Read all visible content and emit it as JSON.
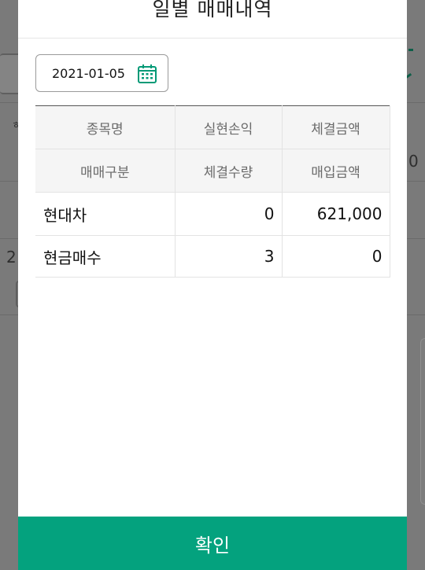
{
  "background": {
    "dim_color": "#757575",
    "fragments": [
      "2",
      "0"
    ]
  },
  "dialog": {
    "title": "일별 매매내역",
    "date": {
      "value": "2021-01-05",
      "icon": "calendar-icon"
    },
    "table": {
      "headers_row1": [
        "종목명",
        "실현손익",
        "체결금액"
      ],
      "headers_row2": [
        "매매구분",
        "체결수량",
        "매입금액"
      ],
      "rows": [
        {
          "line1": [
            "현대차",
            "0",
            "621,000"
          ],
          "line2": [
            "현금매수",
            "3",
            "0"
          ]
        }
      ]
    },
    "confirm_label": "확인"
  },
  "colors": {
    "accent": "#04a27e",
    "header_bg": "#f5f5f5"
  }
}
